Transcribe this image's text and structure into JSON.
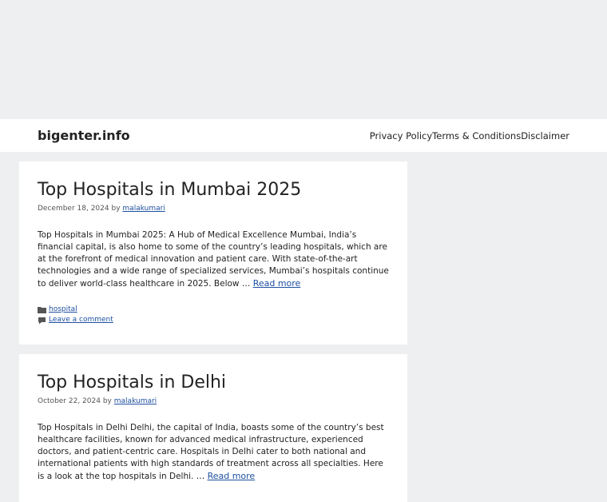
{
  "site": {
    "title": "bigenter.info",
    "nav": [
      {
        "label": "Privacy Policy"
      },
      {
        "label": "Terms & Conditions"
      },
      {
        "label": "Disclaimer"
      }
    ]
  },
  "posts": [
    {
      "title": "Top Hospitals in Mumbai 2025",
      "date": "December 18, 2024",
      "by": "by",
      "author": "malakumari",
      "excerpt": "Top Hospitals in Mumbai 2025: A Hub of Medical Excellence Mumbai, India’s financial capital, is also home to some of the country’s leading hospitals, which are at the forefront of medical innovation and patient care. With state-of-the-art technologies and a wide range of specialized services, Mumbai’s hospitals continue to deliver world-class healthcare in 2025. Below … ",
      "read_more": "Read more",
      "category": "hospital",
      "comment_link": "Leave a comment"
    },
    {
      "title": "Top Hospitals in Delhi",
      "date": "October 22, 2024",
      "by": "by",
      "author": "malakumari",
      "excerpt": "Top Hospitals in Delhi Delhi, the capital of India, boasts some of the country’s best healthcare facilities, known for advanced medical infrastructure, experienced doctors, and patient-centric care. Hospitals in Delhi cater to both national and international patients with high standards of treatment across all specialties. Here is a look at the top hospitals in Delhi. … ",
      "read_more": "Read more"
    }
  ],
  "icons": {
    "category": "folder-icon",
    "comment": "comment-icon"
  }
}
